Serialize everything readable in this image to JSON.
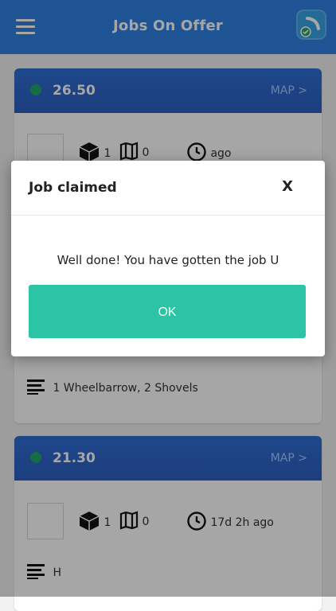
{
  "header": {
    "title": "Jobs On Offer"
  },
  "jobs": [
    {
      "price": "26.50",
      "map_label": "MAP >",
      "items_count": "1",
      "maps_count": "0",
      "time_ago": "ago",
      "description": "1 Wheelbarrow, 2 Shovels"
    },
    {
      "price": "21.30",
      "map_label": "MAP >",
      "items_count": "1",
      "maps_count": "0",
      "time_ago": "17d 2h ago",
      "description": "H"
    }
  ],
  "modal": {
    "title": "Job claimed",
    "close_label": "X",
    "message": "Well done! You have gotten the job U",
    "ok_label": "OK"
  },
  "colors": {
    "header": "#2f80e4",
    "card_top": "#2c5fc1",
    "status_dot": "#22a66a",
    "ok_button": "#2bc4a5"
  }
}
